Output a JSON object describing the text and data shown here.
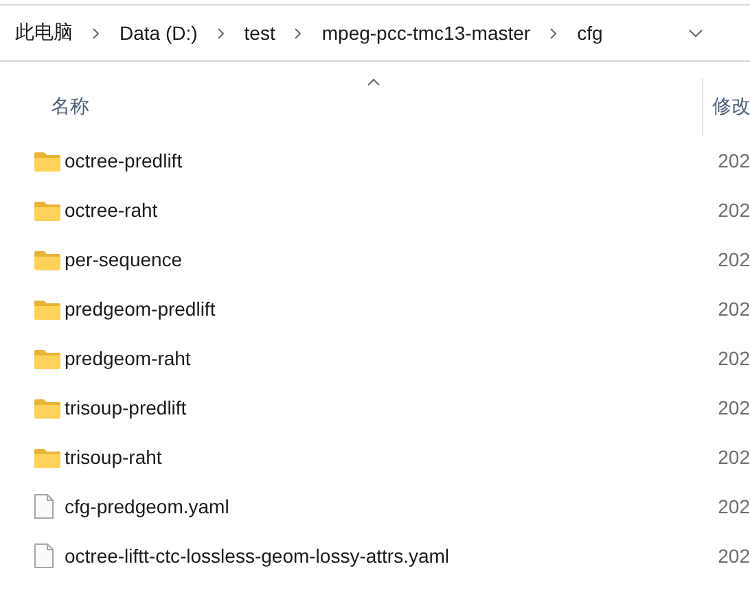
{
  "breadcrumb": [
    "此电脑",
    "Data (D:)",
    "test",
    "mpeg-pcc-tmc13-master",
    "cfg"
  ],
  "columns": [
    {
      "label": "名称",
      "sorted": true
    },
    {
      "label": "修改"
    }
  ],
  "rows": [
    {
      "kind": "folder",
      "name": "octree-predlift",
      "date": "202"
    },
    {
      "kind": "folder",
      "name": "octree-raht",
      "date": "202"
    },
    {
      "kind": "folder",
      "name": "per-sequence",
      "date": "202"
    },
    {
      "kind": "folder",
      "name": "predgeom-predlift",
      "date": "202"
    },
    {
      "kind": "folder",
      "name": "predgeom-raht",
      "date": "202"
    },
    {
      "kind": "folder",
      "name": "trisoup-predlift",
      "date": "202"
    },
    {
      "kind": "folder",
      "name": "trisoup-raht",
      "date": "202"
    },
    {
      "kind": "file",
      "name": "cfg-predgeom.yaml",
      "date": "202"
    },
    {
      "kind": "file",
      "name": "octree-liftt-ctc-lossless-geom-lossy-attrs.yaml",
      "date": "202"
    }
  ]
}
